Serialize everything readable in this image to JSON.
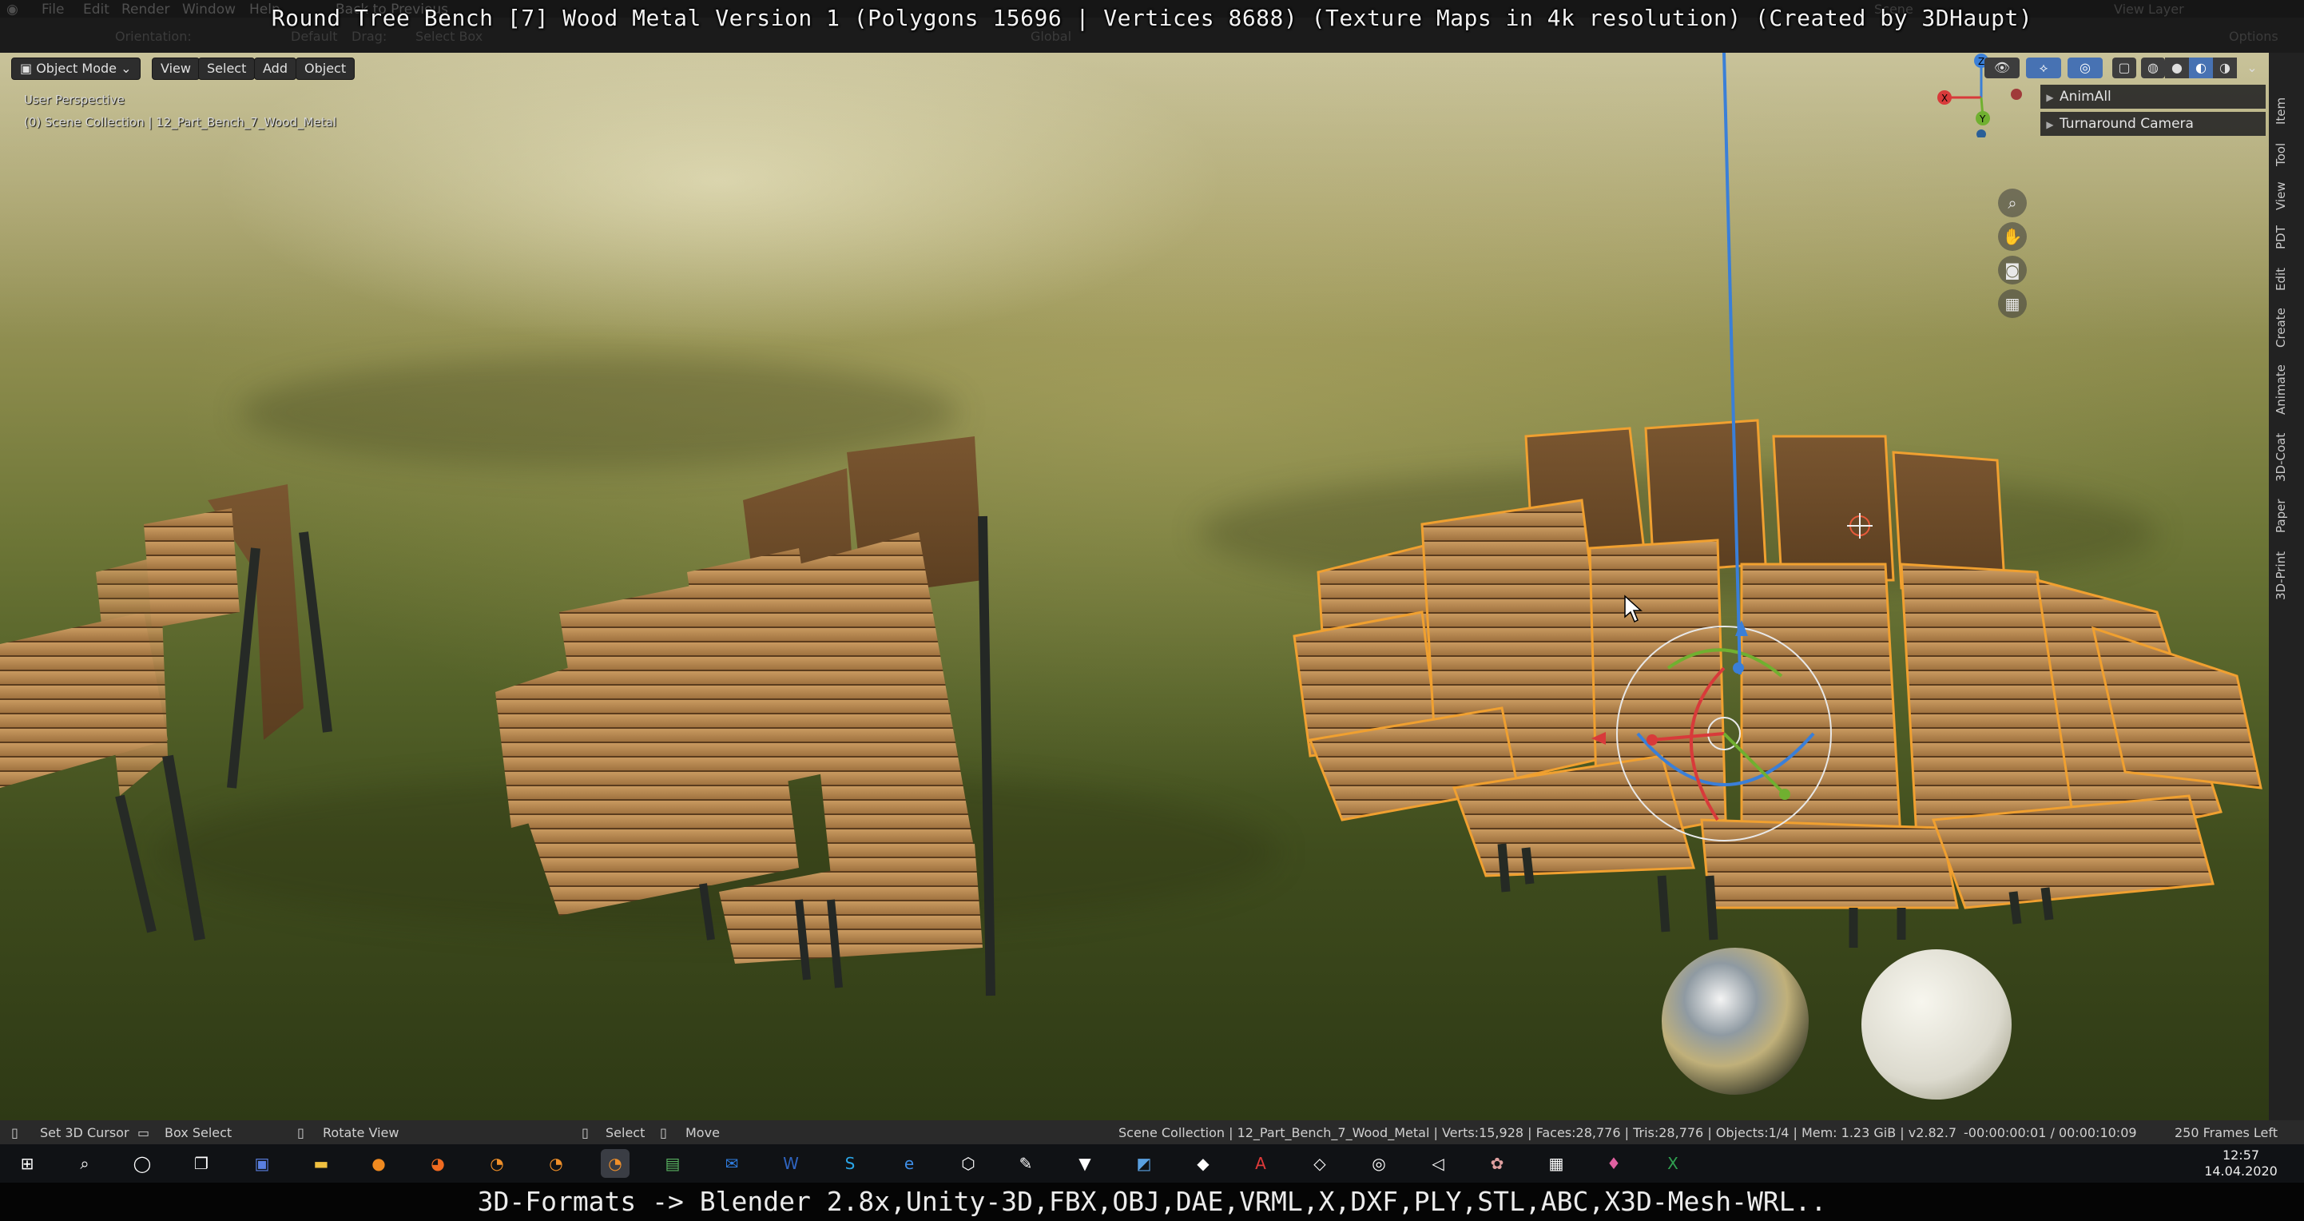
{
  "caption": {
    "title": "Round Tree Bench [7] Wood Metal Version 1 (Polygons 15696 | Vertices 8688) (Texture Maps in 4k resolution) (Created by 3DHaupt)",
    "bottom": "3D-Formats -> Blender 2.8x,Unity-3D,FBX,OBJ,DAE,VRML,X,DXF,PLY,STL,ABC,X3D-Mesh-WRL.."
  },
  "menubar": {
    "items": [
      "File",
      "Edit",
      "Render",
      "Window",
      "Help"
    ],
    "back_to_previous": "Back to Previous",
    "scene": "Scene",
    "view_layer": "View Layer"
  },
  "toolheader": {
    "orientation_label": "Orientation:",
    "orientation_value": "Default",
    "drag_label": "Drag:",
    "drag_value": "Select Box",
    "global": "Global",
    "options": "Options"
  },
  "viewport_header": {
    "mode": "Object Mode",
    "view": "View",
    "select": "Select",
    "add": "Add",
    "object": "Object"
  },
  "viewport": {
    "perspective": "User Perspective",
    "collection_path": "(0) Scene Collection | 12_Part_Bench_7_Wood_Metal",
    "panel_items": [
      "AnimAll",
      "Turnaround Camera"
    ],
    "gizmo_axes": [
      "X",
      "Y",
      "Z"
    ]
  },
  "sidebar_tabs": [
    "Item",
    "Tool",
    "View",
    "PDT",
    "Edit",
    "Create",
    "Animate",
    "3D-Coat",
    "Paper",
    "3D-Print"
  ],
  "statusbar": {
    "set_cursor": "Set 3D Cursor",
    "box_select": "Box Select",
    "rotate_view": "Rotate View",
    "select": "Select",
    "move": "Move",
    "stats": "Scene Collection | 12_Part_Bench_7_Wood_Metal | Verts:15,928 | Faces:28,776 | Tris:28,776 | Objects:1/4 | Mem: 1.23 GiB | v2.82.7",
    "time": "-00:00:00:01 / 00:00:10:09",
    "frames_left": "250 Frames Left"
  },
  "taskbar": {
    "time": "12:57",
    "date": "14.04.2020",
    "icons": [
      "start-icon",
      "search-icon",
      "cortana-icon",
      "task-view-icon",
      "save-app-icon",
      "file-explorer-icon",
      "blender-orange-icon",
      "firefox-icon",
      "blender-icon",
      "blender-2-icon",
      "blender-active-icon",
      "spreadsheet-icon",
      "outlook-icon",
      "word-icon",
      "skype-icon",
      "edge-icon",
      "box-3d-icon",
      "tool-icon",
      "vectorworks-icon",
      "photo-app-icon",
      "cube-app-icon",
      "acrobat-icon",
      "unity-icon",
      "obs-icon",
      "unity-2-icon",
      "paint-icon",
      "calculator-icon",
      "map-pin-icon",
      "excel-icon"
    ]
  },
  "colors": {
    "selection_outline": "#f0a030",
    "wood": "#b8874f",
    "metal": "#2a2d2c"
  }
}
